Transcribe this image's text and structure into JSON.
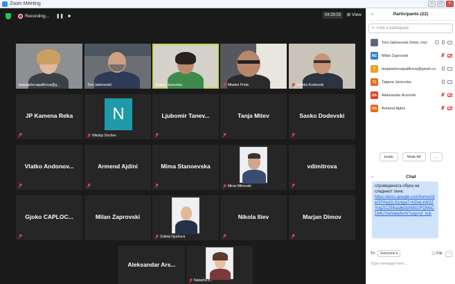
{
  "window": {
    "title": "Zoom Meeting",
    "minimize": "–",
    "maximize": "□",
    "close": "×"
  },
  "toolbar": {
    "recording_label": "Recording...",
    "pause": "❚❚",
    "stop": "■",
    "timer": "04:29:03",
    "view_label": "View"
  },
  "video_tiles": [
    {
      "name": "tanjatashevapalfirova@g..."
    },
    {
      "name": "Toni Jakimovski"
    },
    {
      "name": "Tatjana Janevska"
    },
    {
      "name": "Mladen Protic"
    },
    {
      "name": "Zvonko Kostovski"
    }
  ],
  "name_tiles": {
    "r2": [
      "JP Kamena Reka",
      "Ljubomir Tanev...",
      "Tanja Mitev",
      "Sasko Dodevski"
    ],
    "r2_avatar": {
      "letter": "N",
      "label": "Nikolay Dochev"
    },
    "r3": [
      "Vlatko Andonov...",
      "Armend Ajdini",
      "Mima Stanoevska",
      "vdimitrova"
    ],
    "r3_photo_label": "Miran Mitrevski",
    "r4": [
      "Gjoko CAPLOC...",
      "Milan Zaprovski",
      "Nikola Iliev",
      "Marjan Dimov"
    ],
    "r4_photo_label": "Zulieta Gjurkova",
    "r5": [
      "Aleksandar Ars..."
    ],
    "r5_photo_label": "Natasha K..."
  },
  "participants": {
    "header": "Participants (22)",
    "search_placeholder": "Find a participant",
    "list": [
      {
        "name": "Toni Jakimovski (Host, me)",
        "initials": "",
        "color": "#6b7a8f"
      },
      {
        "name": "Milan Zaprovski",
        "initials": "MZ",
        "color": "#2d7dd2"
      },
      {
        "name": "tanjatashevapalfirova@gmail.com",
        "initials": "T",
        "color": "#f0a020"
      },
      {
        "name": "Tatjana Janevska",
        "initials": "TJ",
        "color": "#e86a1a"
      },
      {
        "name": "Aleksandar Arsovski",
        "initials": "AA",
        "color": "#d9452b"
      },
      {
        "name": "Armend Ajdini",
        "initials": "AA",
        "color": "#e86a1a"
      }
    ],
    "invite": "Invite",
    "mute_all": "Mute All",
    "more": "..."
  },
  "chat": {
    "header": "Chat",
    "message_text": "спроведената обука на следниот линк:",
    "message_link": "https://docs.google.com/forms/d/e/1FAIpQLScnjgaT-mDwLkW2ZYog2I1Z3Ikaq6jOphI8GzFQMsC1b4UYw/viewform?usp=sf_link",
    "to_label": "To:",
    "to_value": "Everyone ▾",
    "file_label": "File",
    "more": "···",
    "input_placeholder": "Type message here..."
  }
}
